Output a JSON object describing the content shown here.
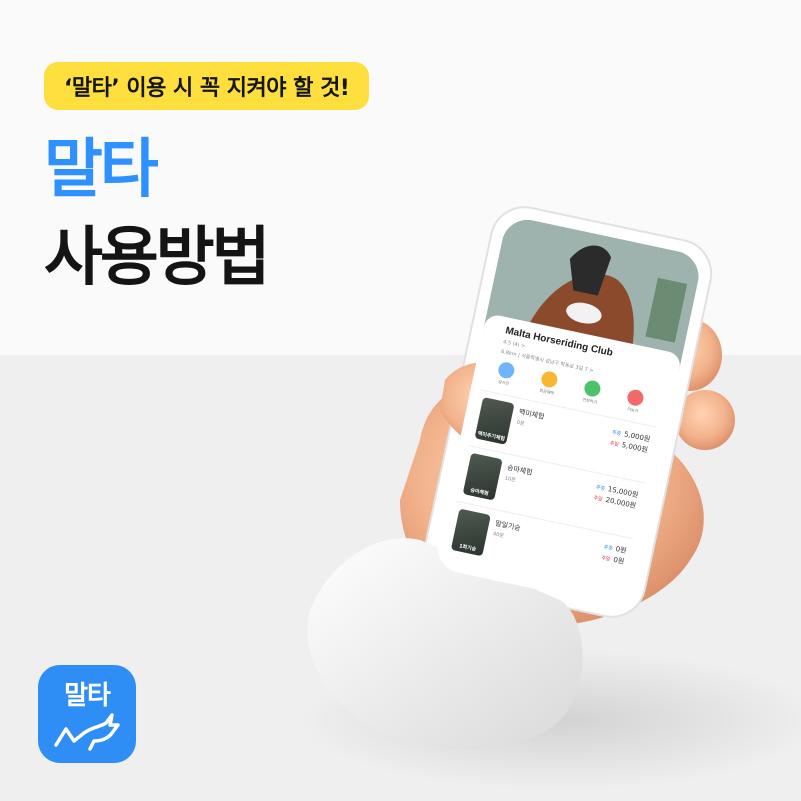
{
  "headline": {
    "badge": "‘말타’ 이용 시 꼭 지켜야 할 것!",
    "title_line1": "말타",
    "title_line2": "사용방법"
  },
  "logo": {
    "text": "말타",
    "icon": "horse-icon"
  },
  "phone": {
    "club_name": "Malta Horseriding Club",
    "rating": "4.5 (4) >",
    "address": "6.8km | 서울특별시 성남구 학동로 3길 7 >",
    "actions": [
      {
        "label": "강사진",
        "icon": "instructor-icon",
        "color": "#6fb4ff"
      },
      {
        "label": "회원혜택",
        "icon": "benefit-icon",
        "color": "#f7b733"
      },
      {
        "label": "전화하기",
        "icon": "phone-icon",
        "color": "#4cc26a"
      },
      {
        "label": "더보기",
        "icon": "more-icon",
        "color": "#f26a6a"
      }
    ],
    "programs": [
      {
        "name": "맥미체험",
        "sub": "0분",
        "thumb_label": "맥미주기체험",
        "weekday_label": "주중",
        "weekday_price": "5,000원",
        "weekend_label": "주말",
        "weekend_price": "5,000원"
      },
      {
        "name": "승마체험",
        "sub": "10분",
        "thumb_label": "승마체험",
        "weekday_label": "주중",
        "weekday_price": "15,000원",
        "weekend_label": "주말",
        "weekend_price": "20,000원"
      },
      {
        "name": "말일기승",
        "sub": "40분",
        "thumb_label": "1회기승",
        "weekday_label": "주중",
        "weekday_price": "0원",
        "weekend_label": "주말",
        "weekend_price": "0원"
      }
    ]
  },
  "colors": {
    "accent": "#2f90ff",
    "badge": "#ffdf3d",
    "weekend": "#ee3b50"
  }
}
